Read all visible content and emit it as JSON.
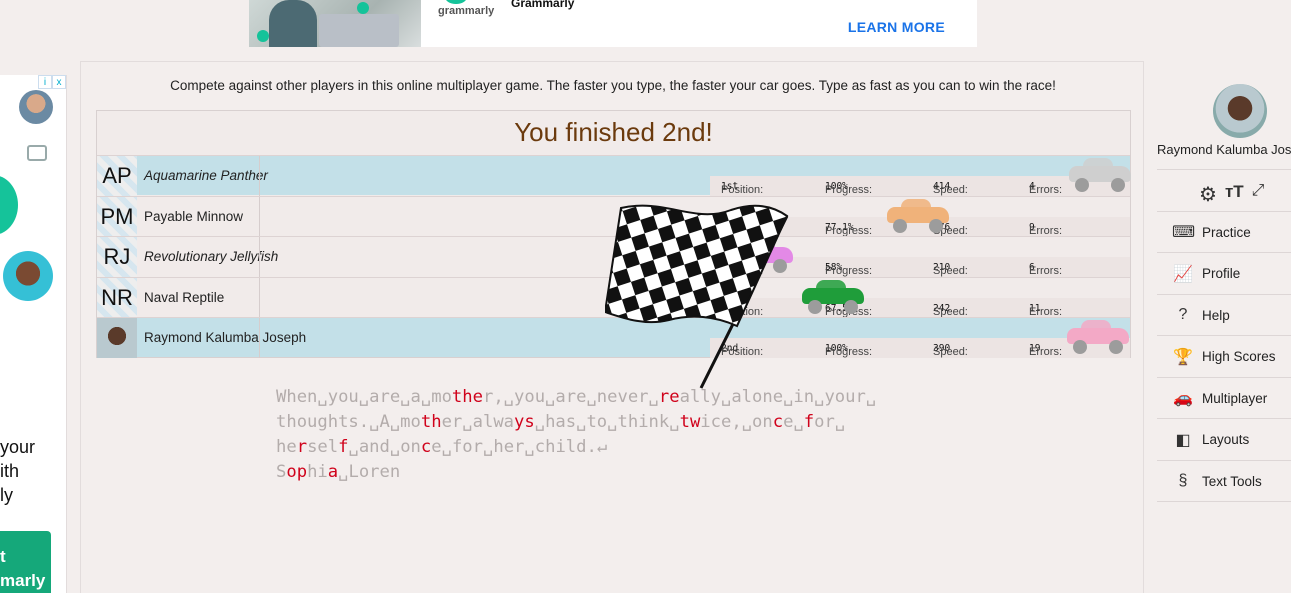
{
  "top_ad": {
    "brand_small": "grammarly",
    "brand_name": "Grammarly",
    "cta": "LEARN MORE"
  },
  "left_ad": {
    "adchoices_i": "i",
    "adchoices_x": "x",
    "text_lines": [
      "your",
      "ith",
      "ly"
    ],
    "button_lines": [
      "t",
      "marly"
    ]
  },
  "intro": "Compete against other players in this online multiplayer game. The faster you type, the faster your car goes. Type as fast as you can to win the race!",
  "race": {
    "title": "You finished 2nd!",
    "stat_labels": {
      "position": "Position:",
      "progress": "Progress:",
      "speed": "Speed:",
      "errors": "Errors:"
    },
    "lanes": [
      {
        "initials": "AP",
        "name": "Aquamarine Panther",
        "italic": true,
        "highlight": true,
        "position": "1st",
        "progress": "100%",
        "speed": "414",
        "errors": "4",
        "car_color": "#cfcfcf"
      },
      {
        "initials": "PM",
        "name": "Payable Minnow",
        "italic": false,
        "highlight": false,
        "position": "3rd",
        "progress": "77.1%",
        "speed": "276",
        "errors": "9",
        "car_color": "#f0b27a"
      },
      {
        "initials": "RJ",
        "name": "Revolutionary Jellyfish",
        "italic": true,
        "highlight": false,
        "position": "5th",
        "progress": "58%",
        "speed": "210",
        "errors": "6",
        "car_color": "#e389e6"
      },
      {
        "initials": "NR",
        "name": "Naval Reptile",
        "italic": false,
        "highlight": false,
        "position": "4th",
        "progress": "67.5%",
        "speed": "242",
        "errors": "11",
        "car_color": "#1f9d3a"
      },
      {
        "initials": "",
        "name": "Raymond Kalumba Joseph",
        "italic": false,
        "highlight": true,
        "position": "2nd",
        "progress": "100%",
        "speed": "390",
        "errors": "19",
        "car_color": "#f3a9c6"
      }
    ]
  },
  "typed_text": [
    [
      [
        "When␣you␣are␣a␣mo",
        0
      ],
      [
        "the",
        1
      ],
      [
        "r,␣you␣are␣never␣",
        0
      ],
      [
        "re",
        1
      ],
      [
        "ally␣alone␣in␣your␣",
        0
      ]
    ],
    [
      [
        "thoughts.␣A␣mo",
        0
      ],
      [
        "th",
        1
      ],
      [
        "er␣alwa",
        0
      ],
      [
        "ys",
        1
      ],
      [
        "␣has␣to␣think␣",
        0
      ],
      [
        "tw",
        1
      ],
      [
        "ice,␣on",
        0
      ],
      [
        "c",
        1
      ],
      [
        "e␣",
        0
      ],
      [
        "f",
        1
      ],
      [
        "or␣",
        0
      ]
    ],
    [
      [
        "he",
        0
      ],
      [
        "r",
        1
      ],
      [
        "sel",
        0
      ],
      [
        "f",
        1
      ],
      [
        "␣and␣on",
        0
      ],
      [
        "c",
        1
      ],
      [
        "e␣for␣her␣child.↵",
        0
      ]
    ],
    [
      [
        "S",
        0
      ],
      [
        "op",
        1
      ],
      [
        "hi",
        0
      ],
      [
        "a",
        1
      ],
      [
        "␣Loren",
        0
      ]
    ]
  ],
  "sidebar": {
    "user_name": "Raymond Kalumba Joseph",
    "tool_icons": [
      "gear-icon",
      "text-size-icon",
      "fullscreen-icon"
    ],
    "menu": [
      {
        "label": "Practice",
        "icon": "keyboard-icon",
        "glyph": "⌨"
      },
      {
        "label": "Profile",
        "icon": "chart-icon",
        "glyph": "📈"
      },
      {
        "label": "Help",
        "icon": "help-icon",
        "glyph": "?"
      },
      {
        "label": "High Scores",
        "icon": "trophy-icon",
        "glyph": "🏆"
      },
      {
        "label": "Multiplayer",
        "icon": "car-icon",
        "glyph": "🚗"
      },
      {
        "label": "Layouts",
        "icon": "layouts-icon",
        "glyph": "◧"
      },
      {
        "label": "Text Tools",
        "icon": "section-icon",
        "glyph": "§"
      }
    ]
  }
}
